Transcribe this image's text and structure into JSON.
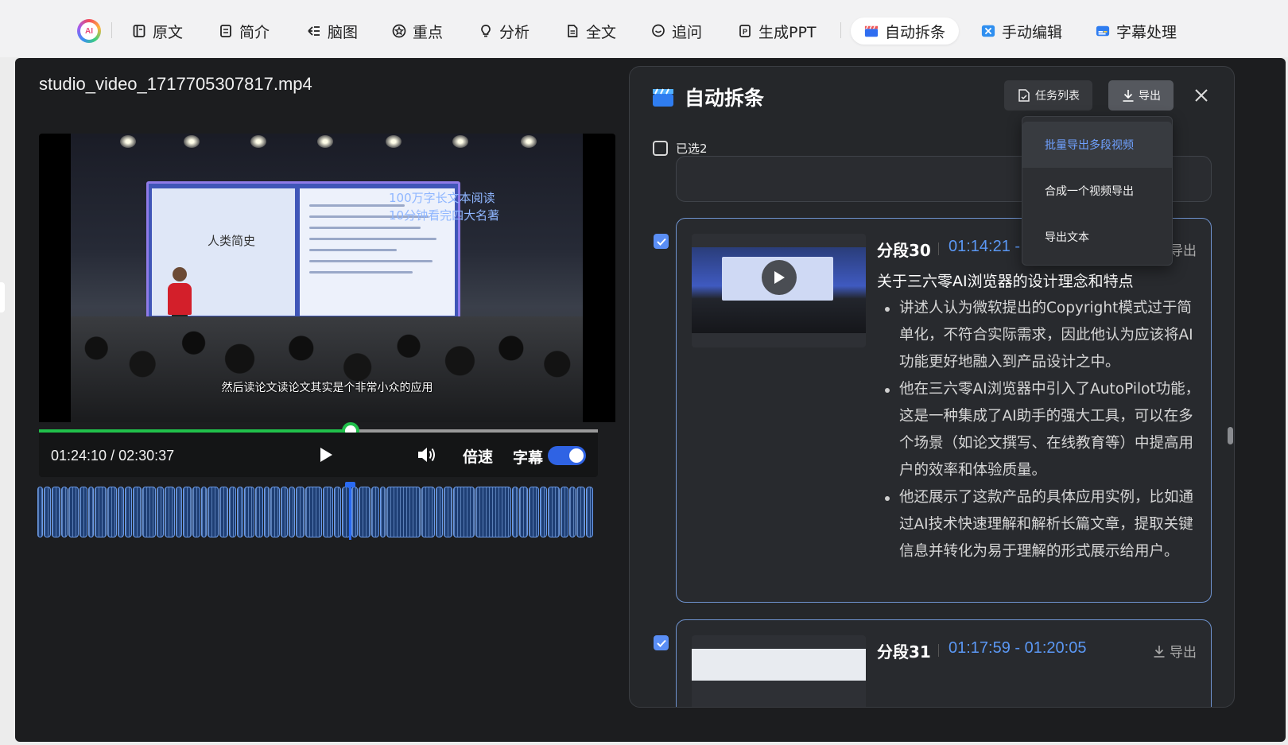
{
  "toolbar": {
    "logo_text": "AI",
    "tabs": [
      {
        "label": "原文",
        "icon": "book-icon"
      },
      {
        "label": "简介",
        "icon": "note-icon"
      },
      {
        "label": "脑图",
        "icon": "mindmap-icon"
      },
      {
        "label": "重点",
        "icon": "star-circle-icon"
      },
      {
        "label": "分析",
        "icon": "bulb-icon"
      },
      {
        "label": "全文",
        "icon": "document-icon"
      },
      {
        "label": "追问",
        "icon": "chat-icon"
      },
      {
        "label": "生成PPT",
        "icon": "ppt-icon"
      },
      {
        "label": "自动拆条",
        "icon": "clapper-icon",
        "active": true
      },
      {
        "label": "手动编辑",
        "icon": "edit-video-icon"
      },
      {
        "label": "字幕处理",
        "icon": "subtitle-icon"
      }
    ]
  },
  "player": {
    "file_name": "studio_video_1717705307817.mp4",
    "slide_slogan_1": "100万字长文本阅读",
    "slide_slogan_2": "10分钟看完四大名著",
    "slide_book": "人类简史",
    "caption": "然后读论文读论文其实是个非常小众的应用",
    "progress": 0.558,
    "time_display": "01:24:10 / 02:30:37",
    "speed_label": "倍速",
    "subtitle_label": "字幕",
    "subtitle_on": true,
    "colors": {
      "progress": "#21c04b",
      "toggle": "#2f63e4"
    }
  },
  "panel": {
    "title": "自动拆条",
    "tasks_label": "任务列表",
    "export_label": "导出",
    "selected_label": "已选2",
    "export_menu": [
      "批量导出多段视频",
      "合成一个视频导出",
      "导出文本"
    ],
    "segments": [
      {
        "name": "分段30",
        "time": "01:14:21 - ",
        "export_label": "导出",
        "checked": true,
        "heading": "关于三六零AI浏览器的设计理念和特点",
        "bullets": [
          "讲述人认为微软提出的Copyright模式过于简单化，不符合实际需求，因此他认为应该将AI功能更好地融入到产品设计之中。",
          "他在三六零AI浏览器中引入了AutoPilot功能，这是一种集成了AI助手的强大工具，可以在多个场景（如论文撰写、在线教育等）中提高用户的效率和体验质量。",
          "他还展示了这款产品的具体应用实例，比如通过AI技术快速理解和解析长篇文章，提取关键信息并转化为易于理解的形式展示给用户。"
        ]
      },
      {
        "name": "分段31",
        "time": "01:17:59 - 01:20:05",
        "export_label": "导出",
        "checked": true
      }
    ]
  }
}
